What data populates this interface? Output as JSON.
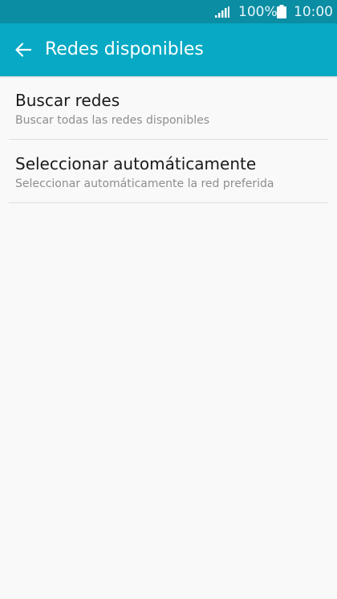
{
  "status_bar": {
    "battery_percent": "100%",
    "time": "10:00",
    "icons": [
      "signal-icon",
      "battery-icon"
    ]
  },
  "app_bar": {
    "title": "Redes disponibles",
    "back_icon": "arrow-left-icon"
  },
  "list": {
    "items": [
      {
        "title": "Buscar redes",
        "subtitle": "Buscar todas las redes disponibles"
      },
      {
        "title": "Seleccionar automáticamente",
        "subtitle": "Seleccionar automáticamente la red preferida"
      }
    ]
  },
  "colors": {
    "status_bar": "#0b8da3",
    "app_bar": "#07a9c4",
    "background": "#f9f9f9",
    "title_text": "#1a1a1a",
    "subtitle_text": "#8e8e8e",
    "divider": "#dedede"
  }
}
